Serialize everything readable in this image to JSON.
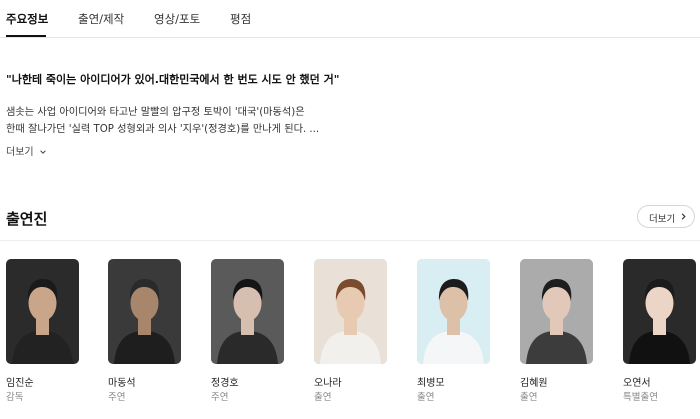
{
  "tabs": [
    {
      "label": "주요정보",
      "active": true
    },
    {
      "label": "출연/제작",
      "active": false
    },
    {
      "label": "영상/포토",
      "active": false
    },
    {
      "label": "평점",
      "active": false
    }
  ],
  "synopsis": {
    "title": "\"나한테 죽이는 아이디어가 있어.대한민국에서 한 번도 시도 안 했던 거\"",
    "lines": [
      "샘솟는 사업 아이디어와 타고난 말빨의 압구정 토박이 '대국'(마동석)은",
      "한때 잘나가던 '실력 TOP 성형외과 의사 '지우'(정경호)를 만나게 된다. ..."
    ],
    "more_label": "더보기"
  },
  "cast_section": {
    "title": "출연진",
    "more_label": "더보기"
  },
  "cast": [
    {
      "name": "임진순",
      "role": "감독",
      "bg": "#2b2b2b",
      "skin": "#c9a58a",
      "hair": "#1a1a1a",
      "cloth": "#222222"
    },
    {
      "name": "마동석",
      "role": "주연",
      "bg": "#3a3a3a",
      "skin": "#a8866c",
      "hair": "#2a2a2a",
      "cloth": "#1e1e1e"
    },
    {
      "name": "정경호",
      "role": "주연",
      "bg": "#5a5a5a",
      "skin": "#d6bfae",
      "hair": "#151515",
      "cloth": "#2a2a2a"
    },
    {
      "name": "오나라",
      "role": "출연",
      "bg": "#e9e1d8",
      "skin": "#e8c9b1",
      "hair": "#7a4b2c",
      "cloth": "#f2f0ec"
    },
    {
      "name": "최병모",
      "role": "출연",
      "bg": "#d9eef3",
      "skin": "#dcc1a8",
      "hair": "#1c1c1c",
      "cloth": "#f4f6f7"
    },
    {
      "name": "김혜원",
      "role": "출연",
      "bg": "#ababab",
      "skin": "#e2c8b8",
      "hair": "#1e1e1e",
      "cloth": "#3c3c3c"
    },
    {
      "name": "오연서",
      "role": "특별출연",
      "bg": "#2a2a2a",
      "skin": "#ead5c7",
      "hair": "#1b1b1b",
      "cloth": "#111111"
    }
  ]
}
